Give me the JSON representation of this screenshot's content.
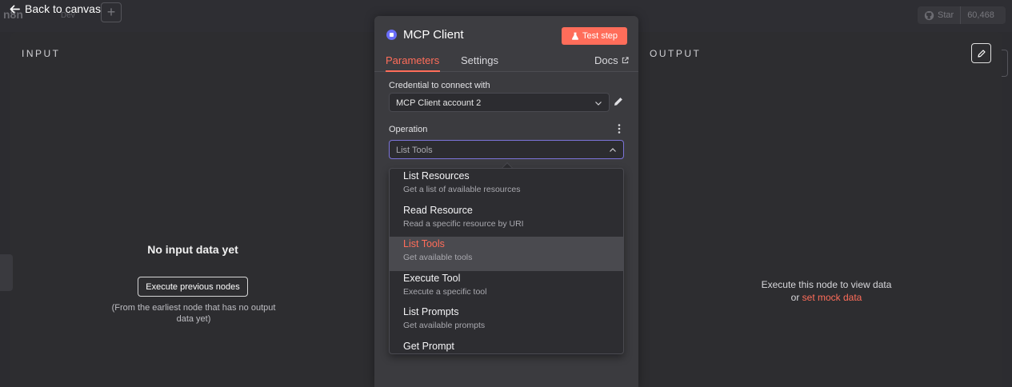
{
  "header": {
    "app_name": "n8n",
    "env": "Dev",
    "back_label": "Back to canvas",
    "plus": "+",
    "github_star_label": "Star",
    "github_star_count": "60,468"
  },
  "input_panel": {
    "title": "INPUT",
    "empty_title": "No input data yet",
    "execute_button": "Execute previous nodes",
    "hint": "(From the earliest node that has no output data yet)"
  },
  "output_panel": {
    "title": "OUTPUT",
    "empty_line1": "Execute this node to view data",
    "empty_or": "or",
    "mock_link": "set mock data"
  },
  "node": {
    "title": "MCP Client",
    "test_button": "Test step",
    "tabs": {
      "parameters": "Parameters",
      "settings": "Settings",
      "docs": "Docs"
    },
    "credential_label": "Credential to connect with",
    "credential_value": "MCP Client account 2",
    "operation_label": "Operation",
    "operation_value": "List Tools"
  },
  "dropdown": {
    "items": [
      {
        "title": "List Resources",
        "desc": "Get a list of available resources"
      },
      {
        "title": "Read Resource",
        "desc": "Read a specific resource by URI"
      },
      {
        "title": "List Tools",
        "desc": "Get available tools"
      },
      {
        "title": "Execute Tool",
        "desc": "Execute a specific tool"
      },
      {
        "title": "List Prompts",
        "desc": "Get available prompts"
      },
      {
        "title": "Get Prompt",
        "desc": ""
      }
    ],
    "selected_index": 2
  },
  "colors": {
    "accent": "#ff6d5a",
    "node_icon": "#6a6ef8",
    "focus_border": "#7c74d9"
  }
}
